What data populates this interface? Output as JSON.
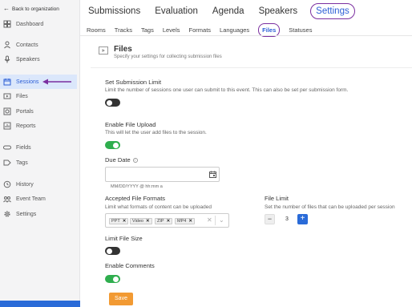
{
  "sidebar": {
    "back_label": "Back to organization",
    "items": [
      {
        "label": "Dashboard",
        "icon": "dashboard-icon"
      },
      {
        "label": "Contacts",
        "icon": "user-icon"
      },
      {
        "label": "Speakers",
        "icon": "microphone-icon"
      },
      {
        "label": "Sessions",
        "icon": "calendar-icon"
      },
      {
        "label": "Files",
        "icon": "play-icon"
      },
      {
        "label": "Portals",
        "icon": "portal-icon"
      },
      {
        "label": "Reports",
        "icon": "chart-icon"
      },
      {
        "label": "Fields",
        "icon": "fields-icon"
      },
      {
        "label": "Tags",
        "icon": "tag-icon"
      },
      {
        "label": "History",
        "icon": "history-icon"
      },
      {
        "label": "Event Team",
        "icon": "team-icon"
      },
      {
        "label": "Settings",
        "icon": "gear-icon"
      }
    ],
    "active": "Sessions",
    "accent_color": "#2c5fd6"
  },
  "topnav": {
    "tabs": [
      "Submissions",
      "Evaluation",
      "Agenda",
      "Speakers",
      "Settings"
    ],
    "active": "Settings"
  },
  "subnav": {
    "tabs": [
      "Rooms",
      "Tracks",
      "Tags",
      "Levels",
      "Formats",
      "Languages",
      "Files",
      "Statuses"
    ],
    "active": "Files"
  },
  "section": {
    "title": "Files",
    "subtitle": "Specify your settings for collecting submission files"
  },
  "settings": {
    "submission_limit": {
      "label": "Set Submission Limit",
      "desc": "Limit the number of sessions one user can submit to this event. This can also be set per submission form.",
      "enabled": false
    },
    "file_upload": {
      "label": "Enable File Upload",
      "desc": "This will let the user add files to the session.",
      "enabled": true
    },
    "due_date": {
      "label": "Due Date",
      "value": "",
      "hint": "MM/DD/YYYY @ hh:mm a"
    },
    "formats": {
      "label": "Accepted File Formats",
      "desc": "Limit what formats of content can be uploaded",
      "chips": [
        "PPT",
        "Video",
        "ZIP",
        "MP4"
      ],
      "clear_glyph": "✕",
      "chevron_glyph": "⌄"
    },
    "file_limit": {
      "label": "File Limit",
      "desc": "Set the number of files that can be uploaded per session",
      "value": "3",
      "minus": "−",
      "plus": "+"
    },
    "file_size": {
      "label": "Limit File Size",
      "enabled": false
    },
    "comments": {
      "label": "Enable Comments",
      "enabled": true
    }
  },
  "save_label": "Save",
  "colors": {
    "toggle_on": "#2fae4e",
    "toggle_off": "#333333",
    "save": "#f29a33",
    "highlight_ring": "#7b2fa0"
  }
}
